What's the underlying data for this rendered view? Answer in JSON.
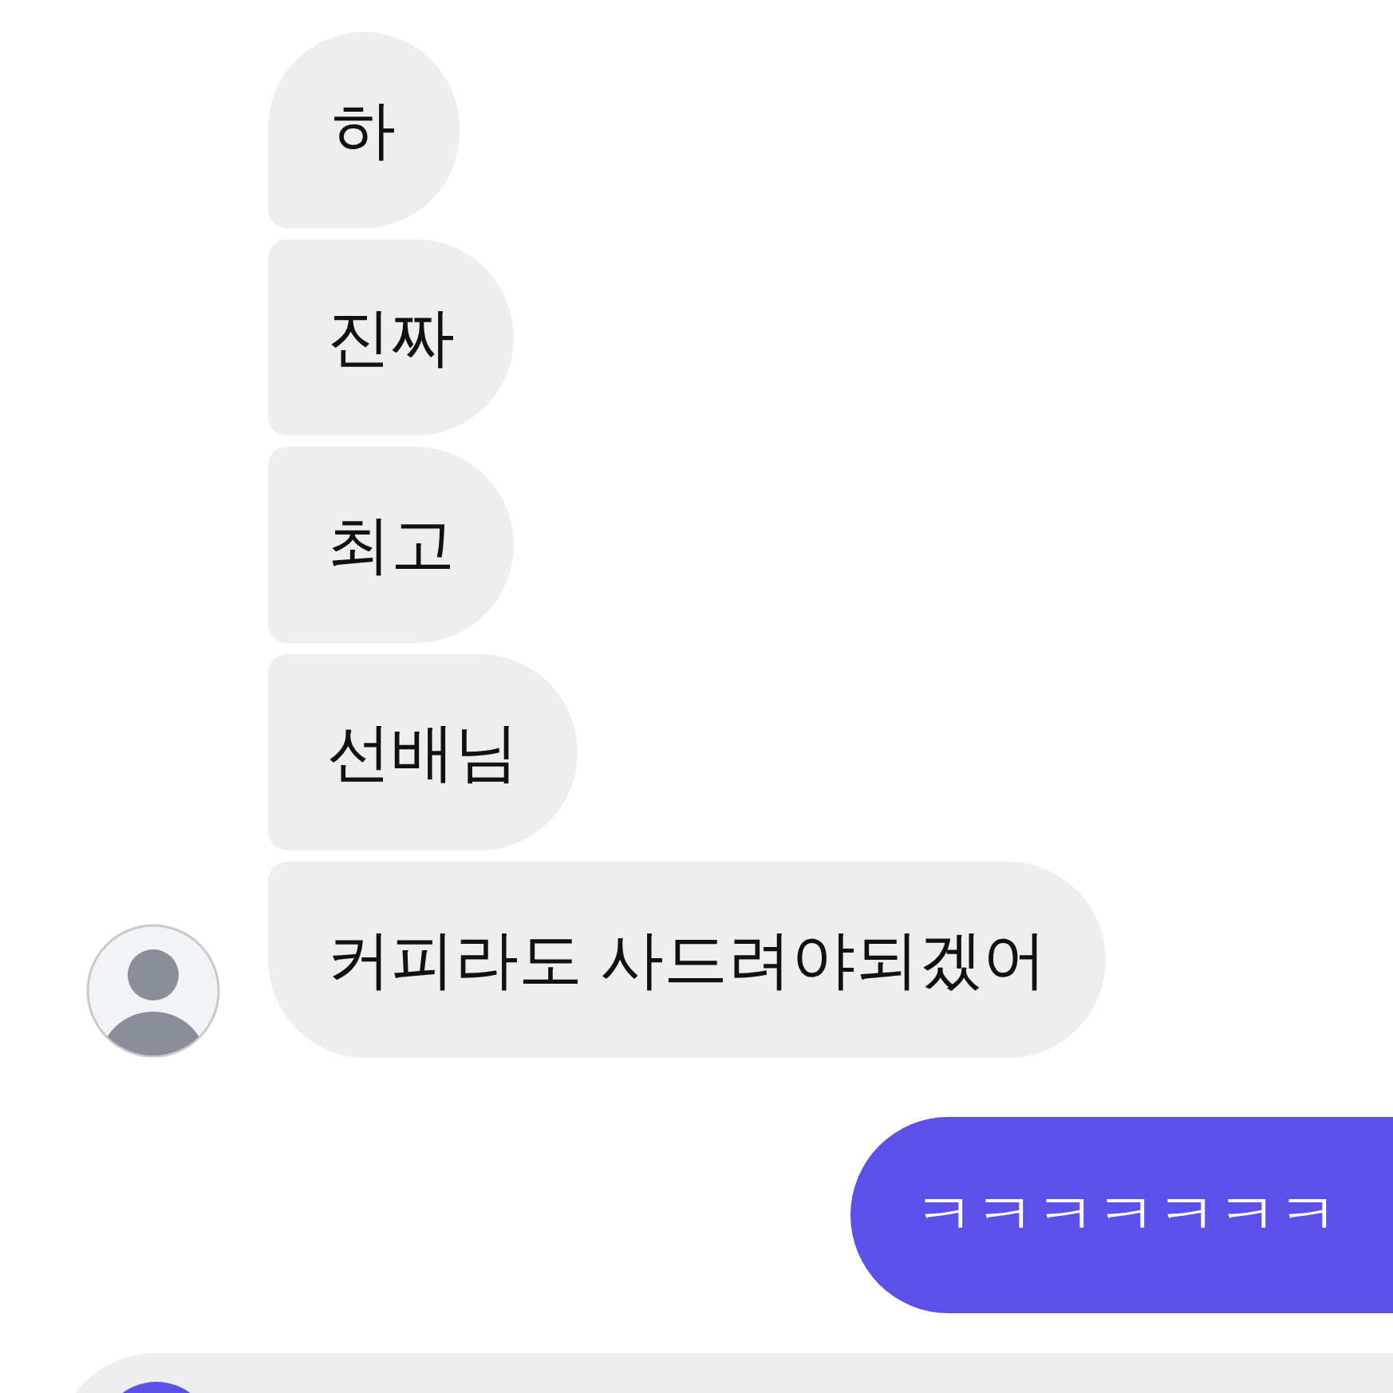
{
  "messages": [
    {
      "kind": "received",
      "text": "하"
    },
    {
      "kind": "received",
      "text": "진짜"
    },
    {
      "kind": "received",
      "text": "최고"
    },
    {
      "kind": "received",
      "text": "선배님"
    },
    {
      "kind": "received",
      "text": "커피라도 사드려야되겠어"
    },
    {
      "kind": "sent",
      "text": "ㅋㅋㅋㅋㅋㅋㅋ"
    }
  ]
}
